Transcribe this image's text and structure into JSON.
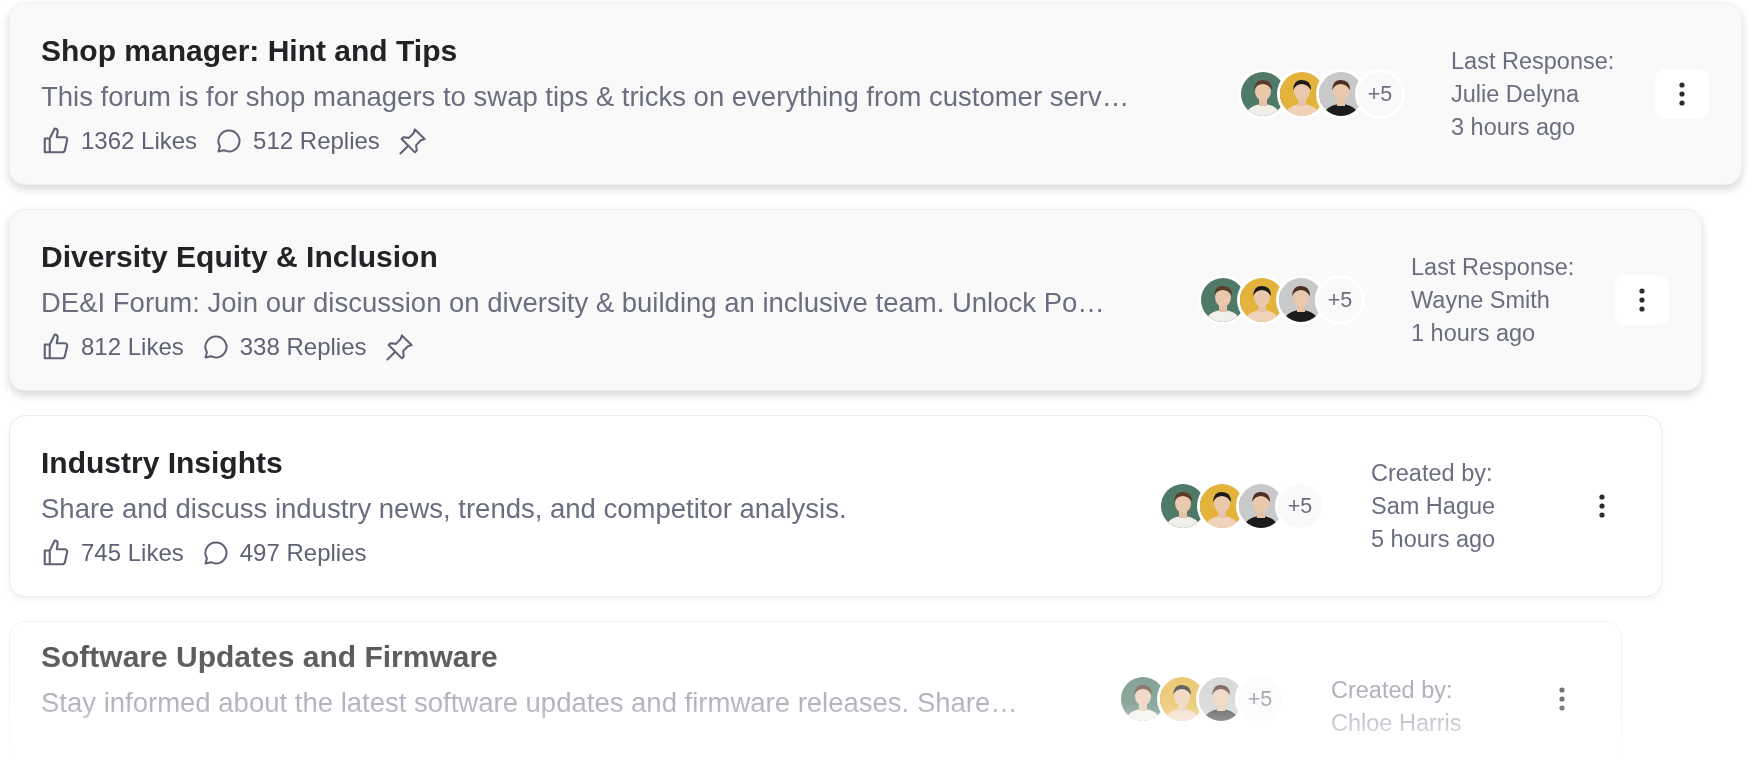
{
  "threads": [
    {
      "title": "Shop manager: Hint and Tips",
      "description": "This forum is for shop managers to swap tips & tricks on everything from customer serv…",
      "likes": "1362 Likes",
      "replies": "512 Replies",
      "pinned": true,
      "highlighted": true,
      "faded": false,
      "extra_count": "+5",
      "info_label": "Last Response:",
      "info_name": "Julie Delyna",
      "info_time": "3 hours ago"
    },
    {
      "title": "Diversity Equity & Inclusion",
      "description": "DE&I Forum: Join our discussion on diversity & building an inclusive team. Unlock Po…",
      "likes": "812 Likes",
      "replies": "338 Replies",
      "pinned": true,
      "highlighted": true,
      "faded": false,
      "extra_count": "+5",
      "info_label": "Last Response:",
      "info_name": "Wayne Smith",
      "info_time": "1 hours ago"
    },
    {
      "title": "Industry Insights",
      "description": "Share and discuss industry news, trends, and competitor analysis.",
      "likes": "745 Likes",
      "replies": "497 Replies",
      "pinned": false,
      "highlighted": false,
      "faded": false,
      "extra_count": "+5",
      "info_label": "Created by:",
      "info_name": "Sam Hague",
      "info_time": "5 hours ago"
    },
    {
      "title": "Software Updates and Firmware",
      "description": "Stay informed about the latest software updates and firmware releases. Share…",
      "highlighted": false,
      "faded": true,
      "extra_count": "+5",
      "info_label": "Created by:",
      "info_name": "Chloe Harris"
    }
  ]
}
